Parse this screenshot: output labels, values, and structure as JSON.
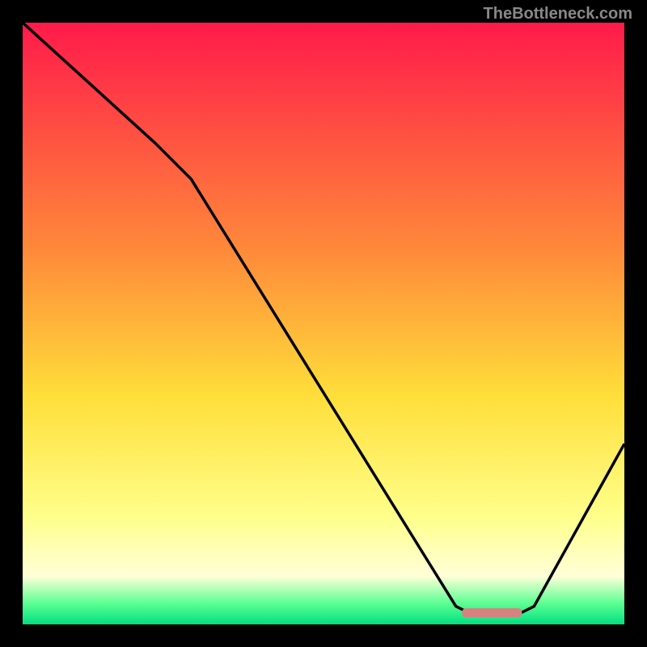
{
  "watermark": "TheBottleneck.com",
  "chart_data": {
    "type": "line",
    "title": "",
    "xlabel": "",
    "ylabel": "",
    "xlim": [
      0,
      100
    ],
    "ylim": [
      0,
      100
    ],
    "gradient_stops": [
      {
        "offset": 0.0,
        "color": "#ff1a4a"
      },
      {
        "offset": 0.38,
        "color": "#ff8a3a"
      },
      {
        "offset": 0.62,
        "color": "#ffde3a"
      },
      {
        "offset": 0.82,
        "color": "#ffff8a"
      },
      {
        "offset": 0.92,
        "color": "#ffffd8"
      },
      {
        "offset": 0.965,
        "color": "#5cff92"
      },
      {
        "offset": 1.0,
        "color": "#00e080"
      }
    ],
    "curve_points": [
      {
        "x": 0,
        "y": 100
      },
      {
        "x": 22,
        "y": 80
      },
      {
        "x": 28,
        "y": 74
      },
      {
        "x": 72,
        "y": 3
      },
      {
        "x": 75,
        "y": 1.5
      },
      {
        "x": 82,
        "y": 1.5
      },
      {
        "x": 85,
        "y": 3
      },
      {
        "x": 100,
        "y": 30
      }
    ],
    "marker": {
      "x_start": 73,
      "x_end": 83,
      "y": 2,
      "color": "#d98080"
    }
  }
}
